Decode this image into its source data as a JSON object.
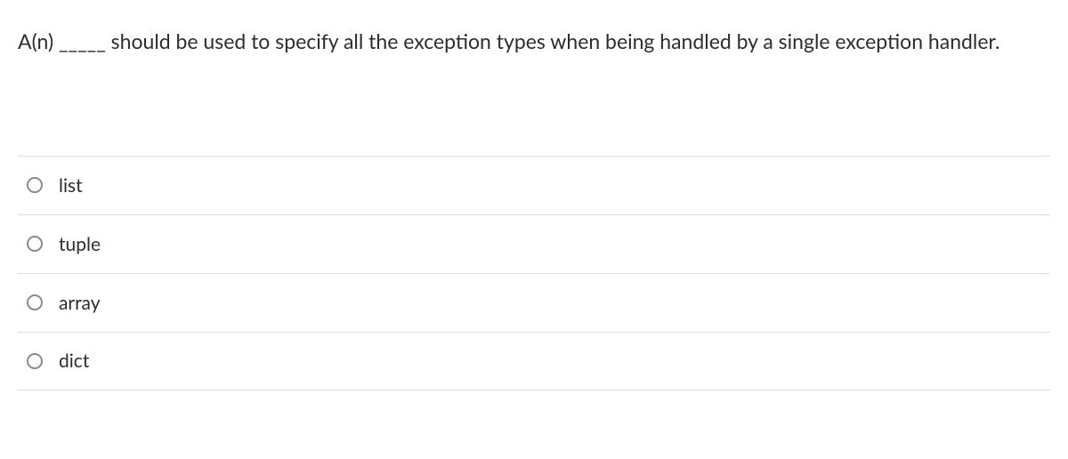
{
  "question": {
    "text": "A(n) _____ should be used to specify all the exception types when being handled by a single exception handler."
  },
  "options": [
    {
      "label": "list"
    },
    {
      "label": "tuple"
    },
    {
      "label": "array"
    },
    {
      "label": "dict"
    }
  ]
}
